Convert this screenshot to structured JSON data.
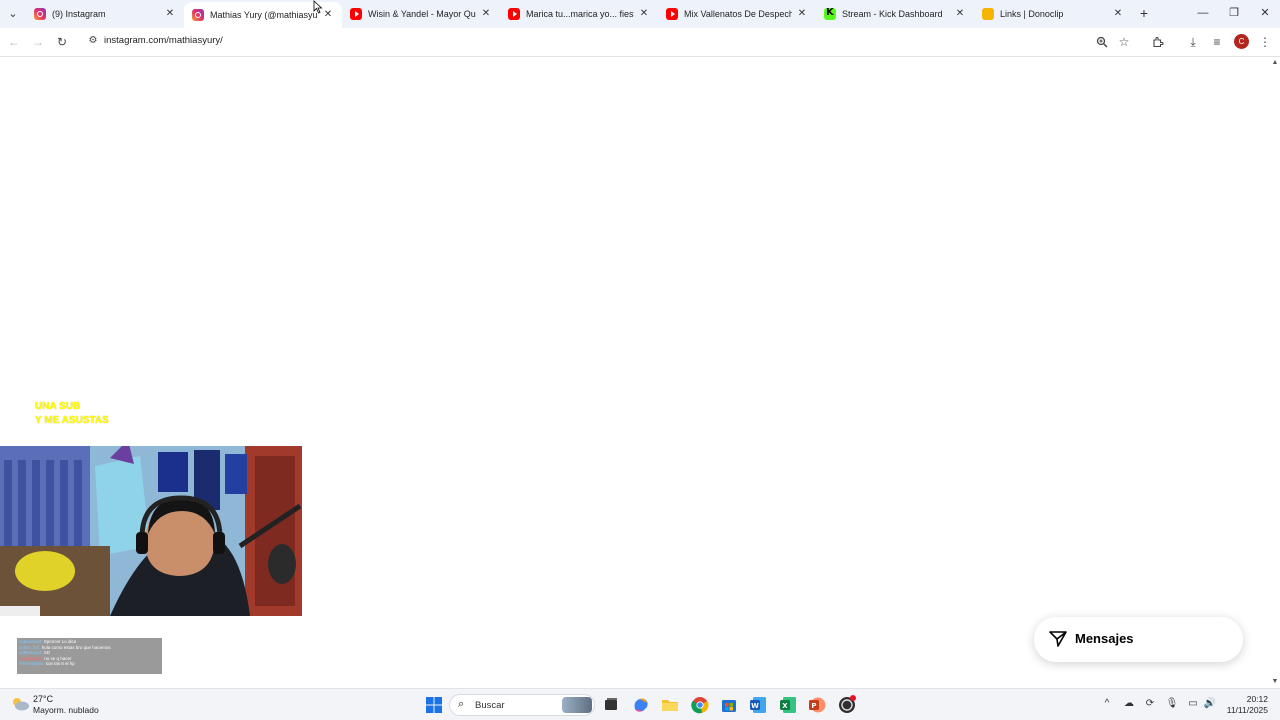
{
  "tabs": [
    {
      "title": "(9) Instagram",
      "favicon": "instagram-icon",
      "active": false
    },
    {
      "title": "Mathias Yury (@mathiasyury) •",
      "favicon": "instagram-icon",
      "active": true
    },
    {
      "title": "Wisin & Yandel - Mayor Que Yo",
      "favicon": "youtube-icon",
      "active": false
    },
    {
      "title": "Marica tu...marica yo... fiesta pla",
      "favicon": "youtube-icon",
      "active": false
    },
    {
      "title": "Mix Vallenatos De Despecho, Va",
      "favicon": "youtube-icon",
      "active": false
    },
    {
      "title": "Stream - Kick Dashboard",
      "favicon": "kick-icon",
      "active": false
    },
    {
      "title": "Links | Donoclip",
      "favicon": "donoclip-icon",
      "active": false
    }
  ],
  "address_bar": {
    "url": "instagram.com/mathiasyury/"
  },
  "profile": {
    "initial": "C",
    "color": "#b3261e"
  },
  "stream_overlay": {
    "line1": "UNA SUB",
    "line2": "Y ME ASUSTAS",
    "color": "#ffff00"
  },
  "chat_overlay": {
    "lines": [
      {
        "user": "mikutowix3:",
        "text": "Spencer Lo dice"
      },
      {
        "user": "cellos_fan:",
        "text": "hola como estas bro que hacemos"
      },
      {
        "user": "mikutowix3:",
        "text": "XD"
      },
      {
        "user": "Rambodoki:",
        "text": "no se q hacer"
      },
      {
        "user": "Friendsisdie:",
        "text": "son las 8 el hp"
      }
    ]
  },
  "messages_button": {
    "label": "Mensajes"
  },
  "taskbar": {
    "weather_temp": "27°C",
    "weather_desc": "Mayorm. nublado",
    "search_placeholder": "Buscar",
    "time": "20:12",
    "date": "11/11/2025"
  }
}
